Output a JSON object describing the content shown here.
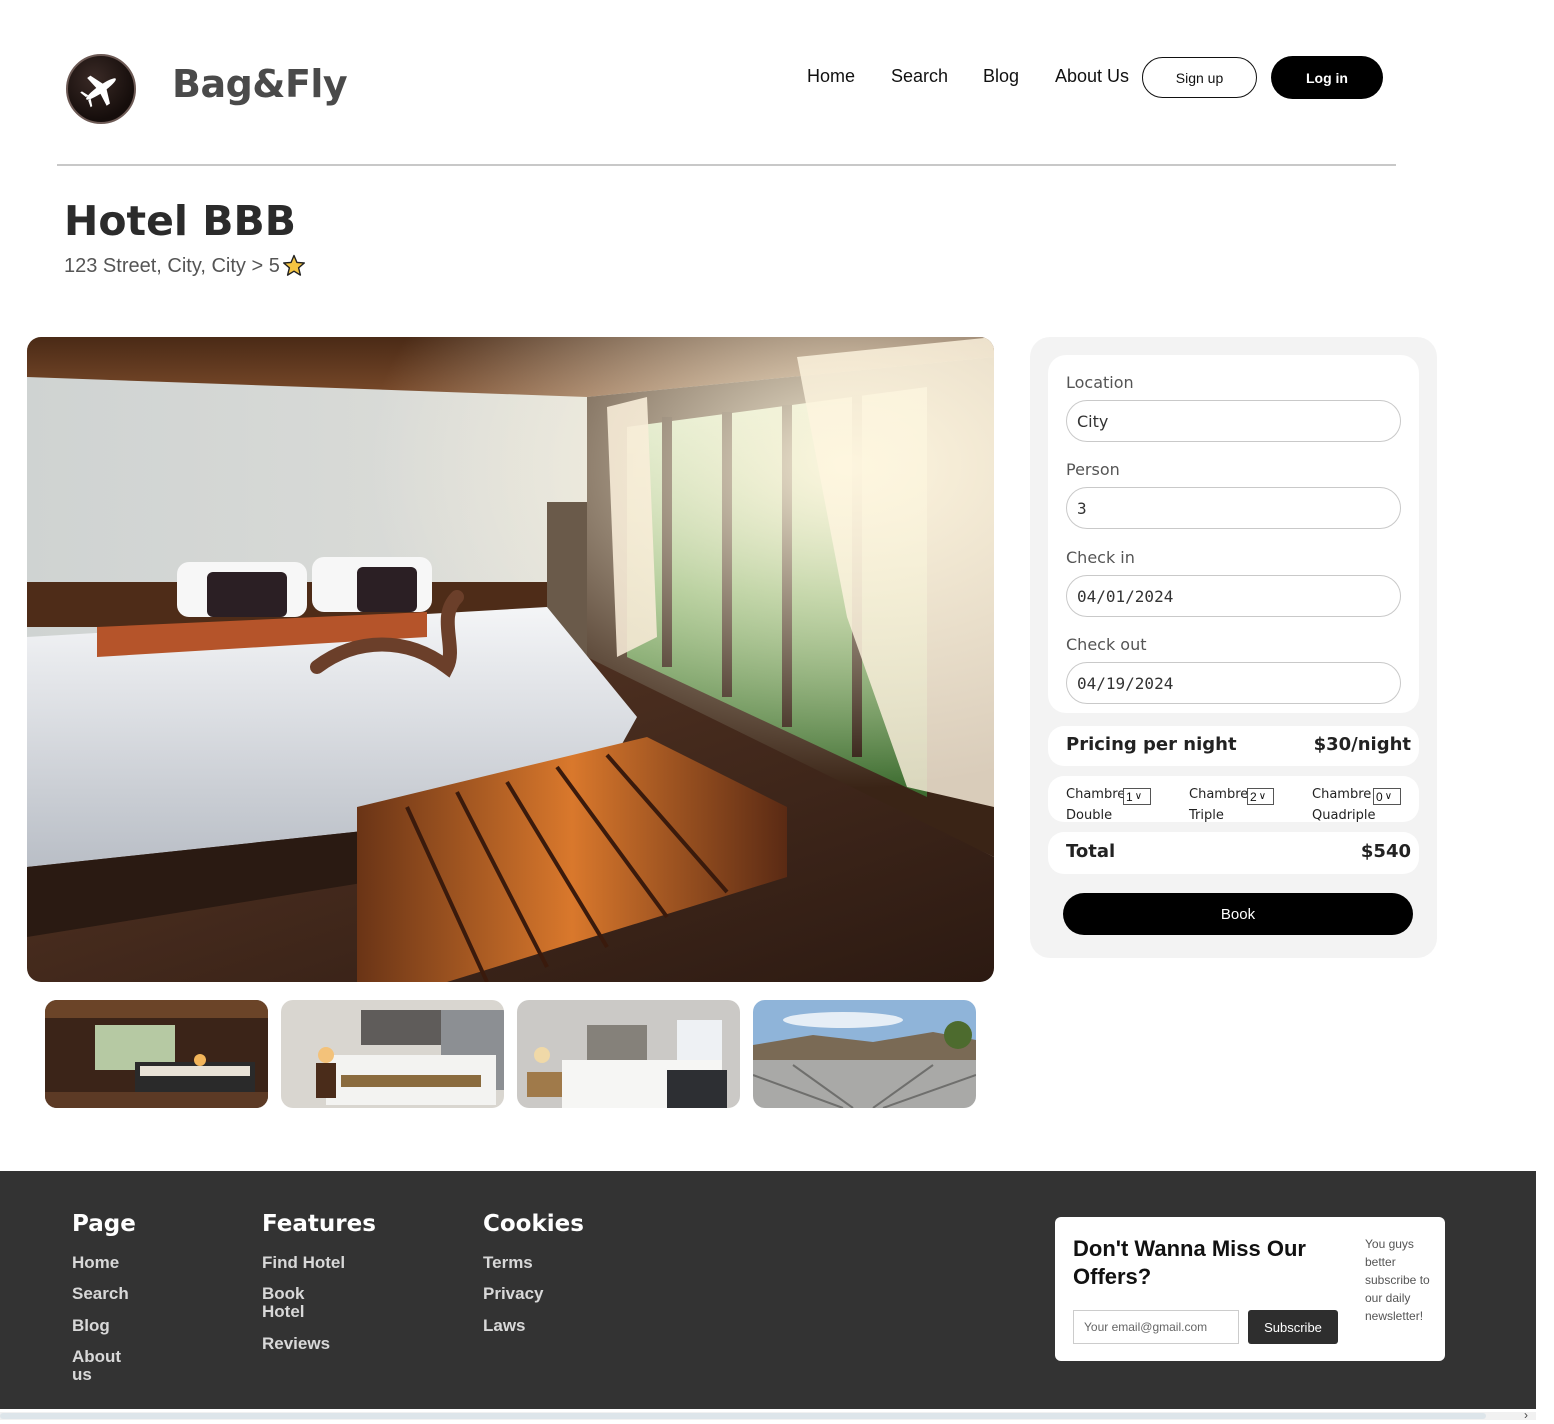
{
  "brand": {
    "name": "Bag&Fly"
  },
  "nav": {
    "home": "Home",
    "search": "Search",
    "blog": "Blog",
    "about": "About Us",
    "signup": "Sign up",
    "login": "Log in"
  },
  "hotel": {
    "name": "Hotel BBB",
    "address": "123 Street, City, City > 5",
    "rating_icon": "star-icon"
  },
  "booking": {
    "location_label": "Location",
    "location_value": "City",
    "person_label": "Person",
    "person_value": "3",
    "checkin_label": "Check in",
    "checkin_value": "04/01/2024",
    "checkout_label": "Check out",
    "checkout_value": "04/19/2024",
    "pricing_label": "Pricing per night",
    "pricing_value": "$30/night",
    "rooms": [
      {
        "line1": "Chambre",
        "line2": "Double",
        "selected": "1"
      },
      {
        "line1": "Chambre",
        "line2": "Triple",
        "selected": "2"
      },
      {
        "line1": "Chambre",
        "line2": "Quadriple",
        "selected": "0"
      }
    ],
    "total_label": "Total",
    "total_value": "$540",
    "book_label": "Book"
  },
  "footer": {
    "page": {
      "title": "Page",
      "links": [
        "Home",
        "Search",
        "Blog",
        "About",
        "us"
      ]
    },
    "features": {
      "title": "Features",
      "links": [
        "Find Hotel",
        "Book",
        "Hotel",
        "Reviews"
      ]
    },
    "cookies": {
      "title": "Cookies",
      "links": [
        "Terms",
        "Privacy",
        "Laws"
      ]
    },
    "newsletter": {
      "title": "Don't Wanna Miss Our Offers?",
      "placeholder": "Your email@gmail.com",
      "button": "Subscribe",
      "side_text": "You guys better subscribe to our daily newsletter!"
    }
  },
  "colors": {
    "primary": "#000000",
    "footer_bg": "#333333",
    "panel_bg": "#f3f3f3",
    "star": "#f5c542"
  }
}
